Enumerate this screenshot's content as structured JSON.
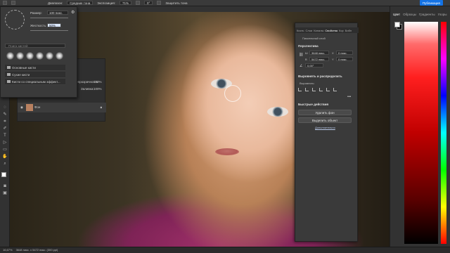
{
  "options_bar": {
    "size_label": "Размер:",
    "size_value": "100 пикс.",
    "mode_label": "Диапазон:",
    "mode_value": "Средние тона",
    "exposure_label": "Экспозиция:",
    "exposure_value": "71%",
    "angle_value": "0°",
    "protect_label": "Защитить тона",
    "publish_label": "Публикация"
  },
  "brush_panel": {
    "size_label": "Размер:",
    "size_value": "100 пикс.",
    "hardness_label": "Жесткость:",
    "hardness_value": "50%",
    "search_placeholder": "Поиск кистей",
    "folders": [
      "Основные кисти",
      "Сухие кисти",
      "Кисти со специальным эффект..."
    ]
  },
  "layers_panel": {
    "opacity_label": "Непрозрачность:",
    "opacity_value": "100%",
    "fill_label": "Заливка:",
    "fill_value": "100%",
    "layer_name": "Фон"
  },
  "properties_panel": {
    "tabs": [
      "Кисть",
      "Слои",
      "Каналы",
      "Свойства",
      "Кор",
      "Библ"
    ],
    "active_tab": "Свойства",
    "layer_type": "Пиксельный слой",
    "transform_title": "Перспектива",
    "w_label": "Ш",
    "w_value": "3648 пикс.",
    "h_label": "В",
    "h_value": "5472 пикс.",
    "x_label": "X",
    "x_value": "0 пикс.",
    "y_label": "Y",
    "y_value": "0 пикс.",
    "angle_value": "0,00°",
    "align_title": "Выровнять и распределить",
    "align_label": "Выровнять:",
    "quick_actions_title": "Быстрые действия",
    "remove_bg": "Удалить фон",
    "select_subject": "Выделить объект",
    "more": "Дополнительно"
  },
  "right_panel": {
    "tabs": [
      "Цвет",
      "Образцы",
      "Градиенты",
      "Узоры"
    ],
    "active_tab": "Цвет"
  },
  "status_bar": {
    "zoom": "16,67%",
    "doc_info": "3648 пикс. x 5472 пикс. (300 ppi)"
  }
}
